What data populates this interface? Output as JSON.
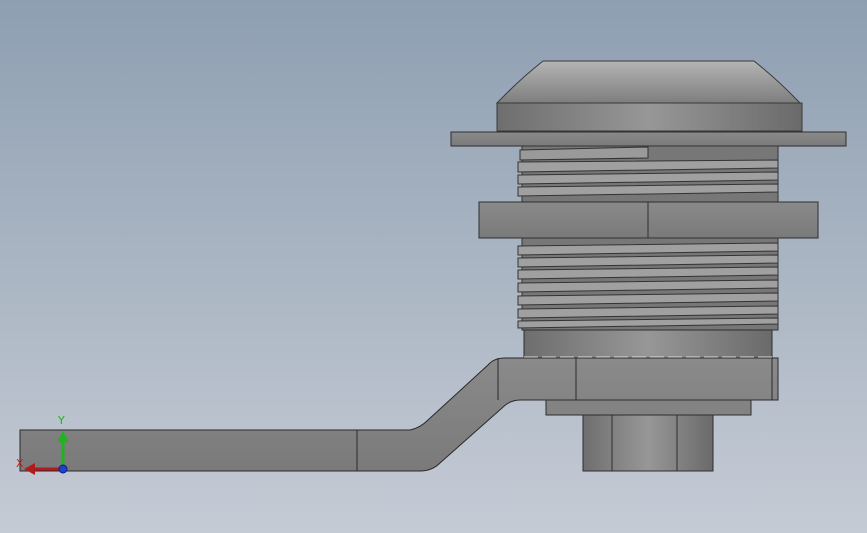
{
  "viewport": {
    "background_top": "#8e9fb2",
    "background_bottom": "#c5cbd5"
  },
  "model": {
    "part_color": "#8c8c8c",
    "edge_color": "#2a2a2a"
  },
  "triad": {
    "y_label": "Y",
    "x_label": "X",
    "y_color": "#1fb31f",
    "x_color": "#c02020",
    "z_color": "#2040d0"
  }
}
